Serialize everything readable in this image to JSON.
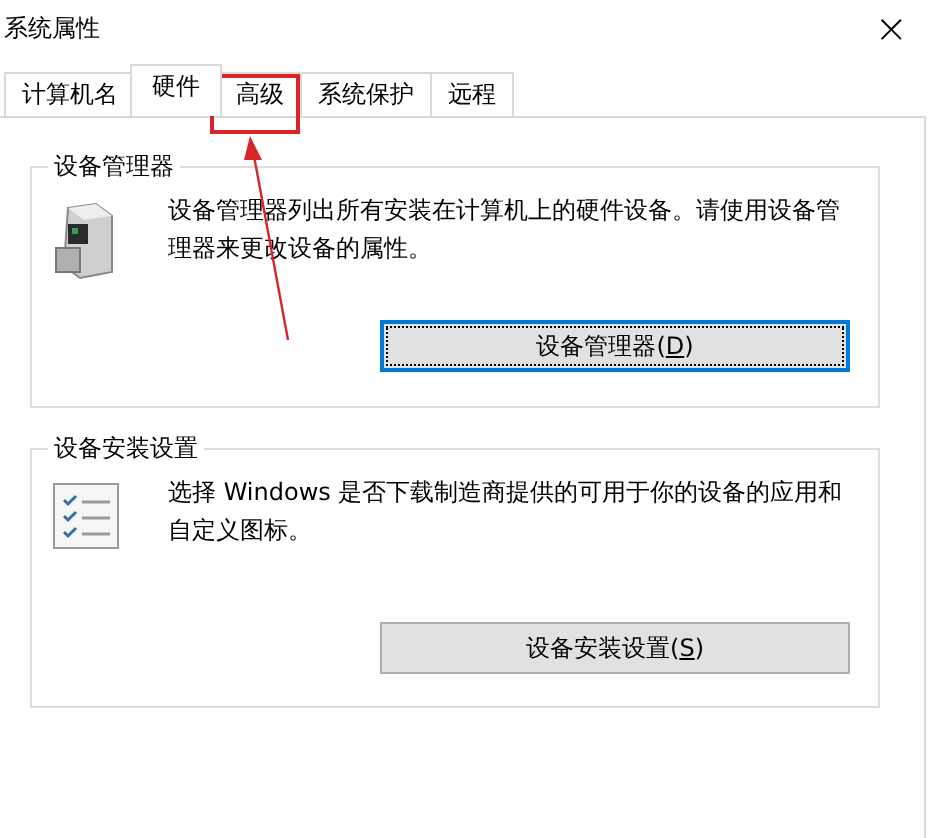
{
  "window": {
    "title": "系统属性",
    "close": "×"
  },
  "tabs": [
    {
      "label": "计算机名",
      "selected": false
    },
    {
      "label": "硬件",
      "selected": true
    },
    {
      "label": "高级",
      "selected": false
    },
    {
      "label": "系统保护",
      "selected": false
    },
    {
      "label": "远程",
      "selected": false
    }
  ],
  "groups": [
    {
      "title": "设备管理器",
      "kind": "device-manager",
      "description": "设备管理器列出所有安装在计算机上的硬件设备。请使用设备管理器来更改设备的属性。",
      "button": {
        "label": "设备管理器(D)",
        "focused": true
      }
    },
    {
      "title": "设备安装设置",
      "kind": "install-settings",
      "description": "选择 Windows 是否下载制造商提供的可用于你的设备的应用和自定义图标。",
      "button": {
        "label": "设备安装设置(S)",
        "focused": false
      }
    }
  ]
}
